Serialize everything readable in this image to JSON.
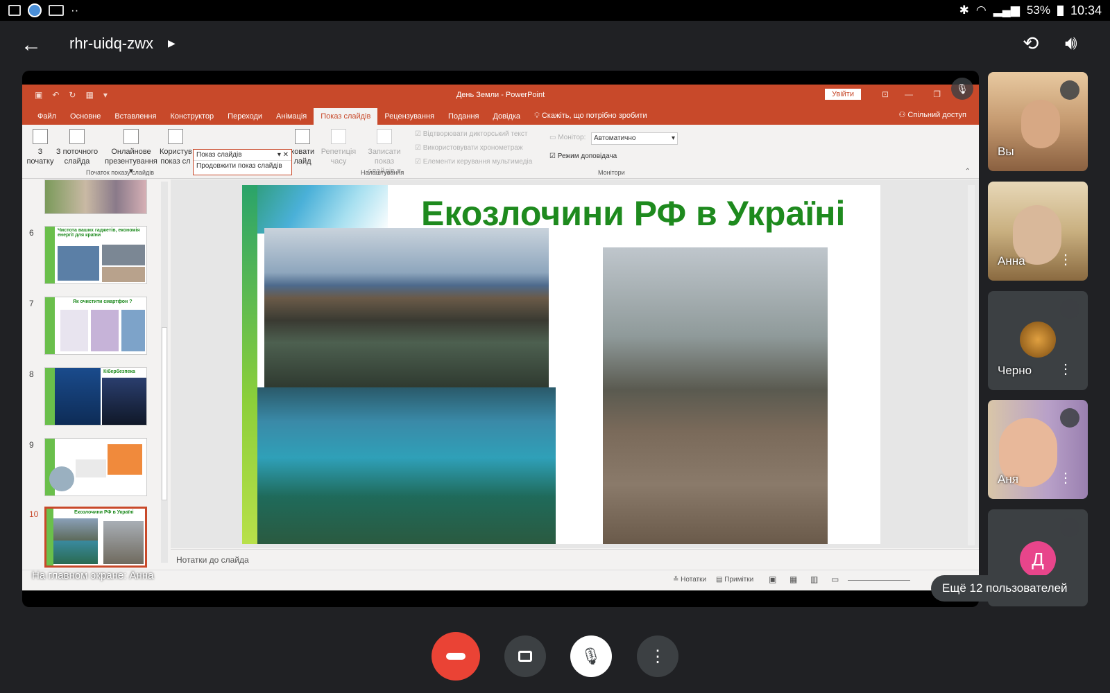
{
  "status_bar": {
    "battery": "53%",
    "time": "10:34",
    "dots": "··"
  },
  "meet": {
    "meeting_code": "rhr-uidq-zwx",
    "presenting_label": "На главном экране: Анна",
    "more_users_label": "Ещё 12 пользователей",
    "participants": [
      {
        "name": "Вы"
      },
      {
        "name": "Анна"
      },
      {
        "name": "Черно"
      },
      {
        "name": "Аня"
      },
      {
        "initial": "Д",
        "color": "#e8458b"
      }
    ]
  },
  "powerpoint": {
    "window_title": "День Земли  -  PowerPoint",
    "login_label": "Увійти",
    "tabs": [
      "Файл",
      "Основне",
      "Вставлення",
      "Конструктор",
      "Переходи",
      "Анімація",
      "Показ слайдів",
      "Рецензування",
      "Подання",
      "Довідка"
    ],
    "active_tab": "Показ слайдів",
    "tell_me": "Скажіть, що потрібно зробити",
    "share_label": "Спільний доступ",
    "ribbon": {
      "from_start": [
        "З",
        "початку"
      ],
      "from_current": [
        "З поточного",
        "слайда"
      ],
      "online": [
        "Онлайнове",
        "презентування ▾"
      ],
      "custom": [
        "Користув",
        "показ сл"
      ],
      "hide": [
        "ховати",
        "лайд"
      ],
      "rehearse": [
        "Репетиція",
        "часу"
      ],
      "record": [
        "Записати показ",
        "слайдів ▾"
      ],
      "group_start": "Початок показу слайдів",
      "group_settings": "Налаштування",
      "group_monitors": "Монітори",
      "check_narration": "Відтворювати дикторський текст",
      "check_timings": "Використовувати хронометраж",
      "check_media": "Елементи керування мультимедіа",
      "monitor_label": "Монітор:",
      "monitor_value": "Автоматично",
      "presenter_view": "Режим доповідача",
      "dropdown_title": "Показ слайдів",
      "dropdown_item": "Продовжити показ слайдів"
    },
    "slide_title": "Екозлочини РФ в Україні",
    "thumbnails": [
      {
        "num": "6",
        "caption": "Чистота ваших гаджетів, економія енергії для країни"
      },
      {
        "num": "7",
        "caption": "Як очистити смартфон ?"
      },
      {
        "num": "8",
        "caption": "Кібербезпека"
      },
      {
        "num": "9",
        "caption": ""
      },
      {
        "num": "10",
        "caption": "Екозлочини РФ в Україні"
      }
    ],
    "notes_label": "Нотатки до слайда",
    "status_notes": "Нотатки",
    "status_comments": "Примітки"
  },
  "colors": {
    "ppt_accent": "#c8492a",
    "meet_bg": "#202124",
    "end_call": "#ea4335",
    "title_green": "#1e8a1e"
  }
}
